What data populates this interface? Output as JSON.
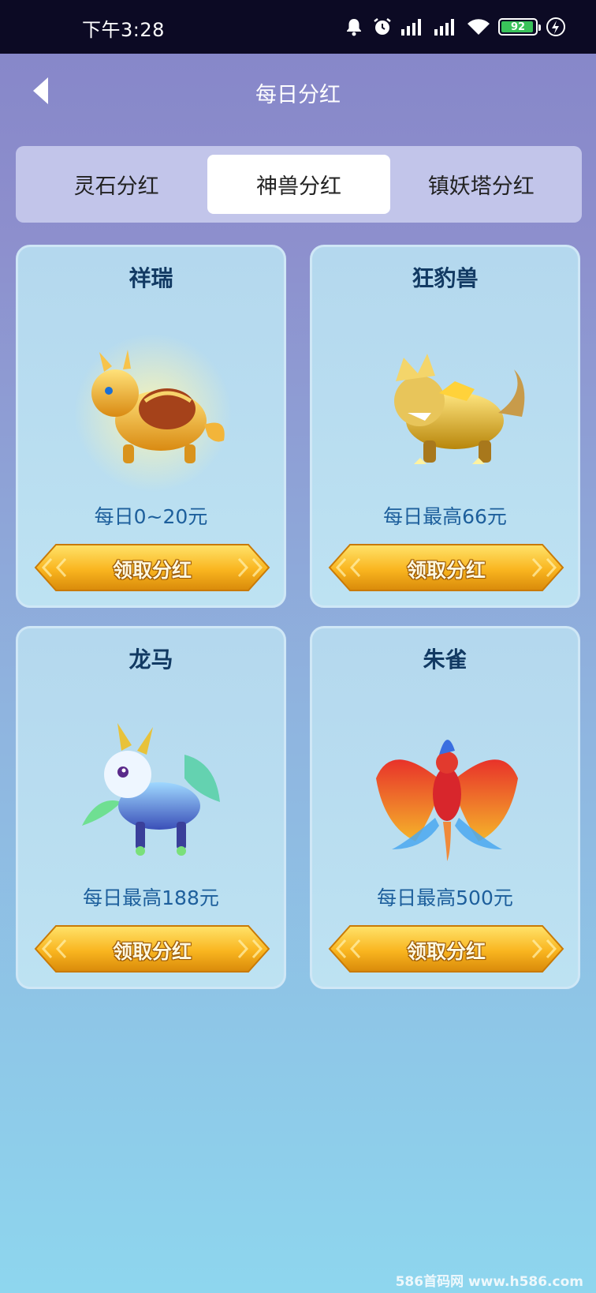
{
  "status_bar": {
    "time": "下午3:28",
    "battery": "92"
  },
  "header": {
    "title": "每日分红"
  },
  "tabs": [
    {
      "label": "灵石分红",
      "active": false
    },
    {
      "label": "神兽分红",
      "active": true
    },
    {
      "label": "镇妖塔分红",
      "active": false
    }
  ],
  "cards": [
    {
      "name": "祥瑞",
      "reward": "每日0~20元",
      "button": "领取分红",
      "icon": "golden-dragon-turtle-icon"
    },
    {
      "name": "狂豹兽",
      "reward": "每日最高66元",
      "button": "领取分红",
      "icon": "golden-leopard-beast-icon"
    },
    {
      "name": "龙马",
      "reward": "每日最高188元",
      "button": "领取分红",
      "icon": "blue-dragon-horse-icon"
    },
    {
      "name": "朱雀",
      "reward": "每日最高500元",
      "button": "领取分红",
      "icon": "red-phoenix-icon"
    }
  ],
  "watermark": "586首码网 www.h586.com"
}
